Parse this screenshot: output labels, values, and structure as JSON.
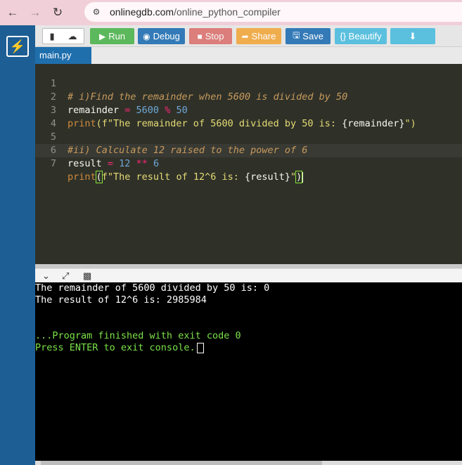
{
  "browser": {
    "url_host": "onlinegdb.com",
    "url_path": "/online_python_compiler"
  },
  "toolbar": {
    "run": "Run",
    "debug": "Debug",
    "stop": "Stop",
    "share": "Share",
    "save": "Save",
    "beautify": "{} Beautify"
  },
  "tab": {
    "filename": "main.py"
  },
  "editor": {
    "line_numbers": [
      "1",
      "2",
      "3",
      "4",
      "5",
      "6",
      "7"
    ],
    "line1": "# i)Find the remainder when 5600 is divided by 50",
    "line2_var": "remainder",
    "line2_eq": " = ",
    "line2_a": "5600",
    "line2_op": " % ",
    "line2_b": "50",
    "line3_fn": "print",
    "line3_str": "(f\"The remainder of 5600 divided by 50 is: ",
    "line3_expr": "{remainder}",
    "line3_end": "\")",
    "line5": "#ii) Calculate 12 raised to the power of 6",
    "line6_var": "result",
    "line6_eq": " = ",
    "line6_a": "12",
    "line6_op": " ** ",
    "line6_b": "6",
    "line7_fn": "print",
    "line7_paren": "(",
    "line7_str": "f\"The result of 12^6 is: ",
    "line7_expr": "{result}",
    "line7_quote": "\"",
    "line7_close": ")"
  },
  "console": {
    "out1": "The remainder of 5600 divided by 50 is: 0",
    "out2": "The result of 12^6 is: 2985984",
    "finish": "...Program finished with exit code 0",
    "prompt": "Press ENTER to exit console."
  },
  "colors": {
    "rail": "#1d5e94",
    "run": "#5cb85c",
    "debug": "#337ab7",
    "stop": "#d9534f",
    "share": "#f0ad4e",
    "beautify": "#5bc0de",
    "console_green": "#7be24a"
  }
}
